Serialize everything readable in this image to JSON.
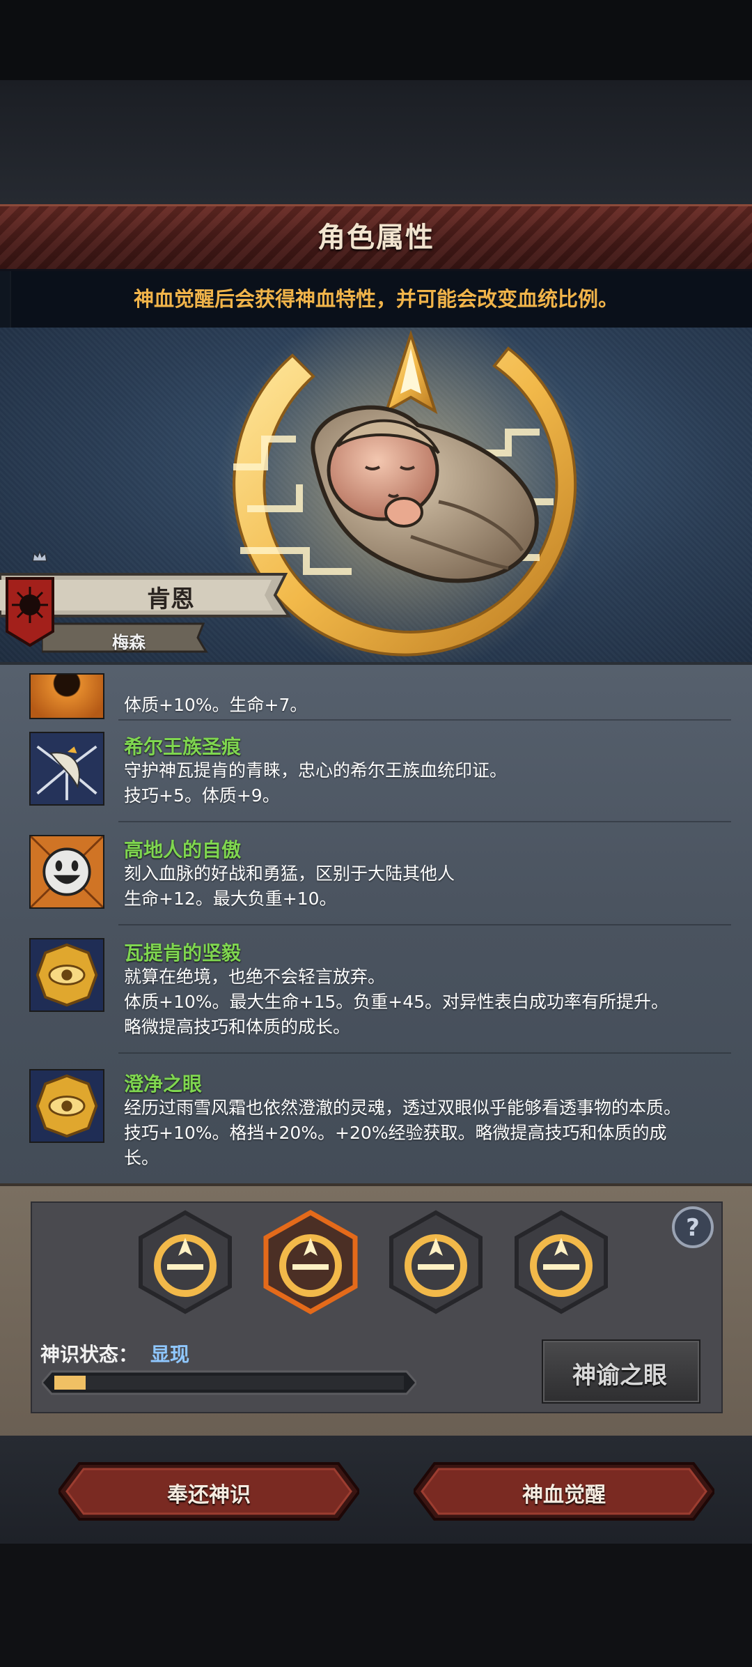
{
  "header": {
    "title": "角色属性"
  },
  "notice": "神血觉醒后会获得神血特性，并可能会改变血统比例。",
  "character": {
    "name": "肯恩",
    "subname": "梅森"
  },
  "traits": [
    {
      "name": "",
      "desc1": "体质+10%。生命+7。",
      "icon": "eye-sun-icon"
    },
    {
      "name": "希尔王族圣痕",
      "desc1": "守护神瓦提肯的青睐，忠心的希尔王族血统印证。",
      "desc2": "技巧+5。体质+9。",
      "icon": "feather-crest-icon"
    },
    {
      "name": "高地人的自傲",
      "desc1": "刻入血脉的好战和勇猛，区别于大陆其他人",
      "desc2": "生命+12。最大负重+10。",
      "icon": "smiley-face-icon"
    },
    {
      "name": "瓦提肯的坚毅",
      "desc1": "就算在绝境，也绝不会轻言放弃。",
      "desc2": "体质+10%。最大生命+15。负重+45。对异性表白成功率有所提升。",
      "desc3": "略微提高技巧和体质的成长。",
      "icon": "golden-eye-medal-icon"
    },
    {
      "name": "澄净之眼",
      "desc1": "经历过雨雪风霜也依然澄澈的灵魂，透过双眼似乎能够看透事物的本质。",
      "desc2": "技巧+10%。格挡+20%。+20%经验获取。略微提高技巧和体质的成",
      "desc3": "长。",
      "icon": "golden-eye-medal-icon"
    }
  ],
  "divine": {
    "status_label": "神识状态：",
    "status_value": "显现",
    "progress": 0.09,
    "selected_slot": 1,
    "slots": 4,
    "oracle_button": "神谕之眼"
  },
  "footer": {
    "return_button": "奉还神识",
    "awaken_button": "神血觉醒"
  },
  "colors": {
    "accent_gold": "#f2b94a",
    "trait_name": "#7fd650",
    "header_red": "#6a2b25",
    "status_blue": "#8fc7ff"
  }
}
